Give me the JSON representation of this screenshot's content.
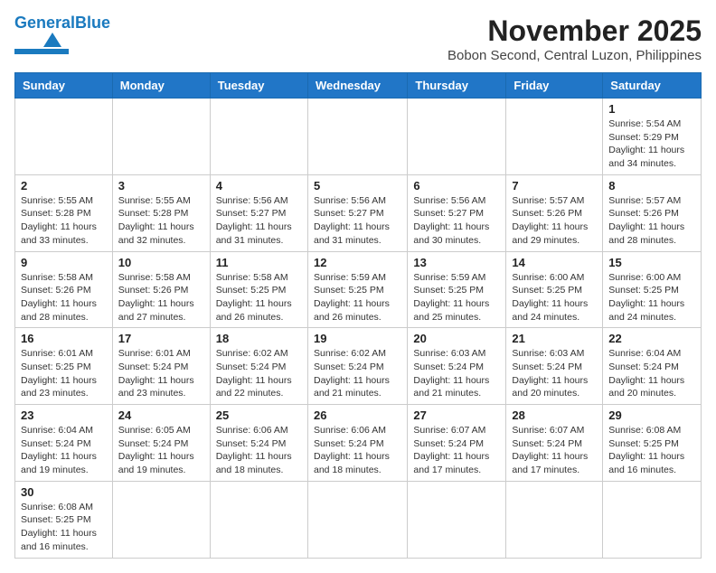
{
  "header": {
    "logo_general": "General",
    "logo_blue": "Blue",
    "month": "November 2025",
    "location": "Bobon Second, Central Luzon, Philippines"
  },
  "days_of_week": [
    "Sunday",
    "Monday",
    "Tuesday",
    "Wednesday",
    "Thursday",
    "Friday",
    "Saturday"
  ],
  "weeks": [
    [
      {
        "day": "",
        "info": ""
      },
      {
        "day": "",
        "info": ""
      },
      {
        "day": "",
        "info": ""
      },
      {
        "day": "",
        "info": ""
      },
      {
        "day": "",
        "info": ""
      },
      {
        "day": "",
        "info": ""
      },
      {
        "day": "1",
        "info": "Sunrise: 5:54 AM\nSunset: 5:29 PM\nDaylight: 11 hours and 34 minutes."
      }
    ],
    [
      {
        "day": "2",
        "info": "Sunrise: 5:55 AM\nSunset: 5:28 PM\nDaylight: 11 hours and 33 minutes."
      },
      {
        "day": "3",
        "info": "Sunrise: 5:55 AM\nSunset: 5:28 PM\nDaylight: 11 hours and 32 minutes."
      },
      {
        "day": "4",
        "info": "Sunrise: 5:56 AM\nSunset: 5:27 PM\nDaylight: 11 hours and 31 minutes."
      },
      {
        "day": "5",
        "info": "Sunrise: 5:56 AM\nSunset: 5:27 PM\nDaylight: 11 hours and 31 minutes."
      },
      {
        "day": "6",
        "info": "Sunrise: 5:56 AM\nSunset: 5:27 PM\nDaylight: 11 hours and 30 minutes."
      },
      {
        "day": "7",
        "info": "Sunrise: 5:57 AM\nSunset: 5:26 PM\nDaylight: 11 hours and 29 minutes."
      },
      {
        "day": "8",
        "info": "Sunrise: 5:57 AM\nSunset: 5:26 PM\nDaylight: 11 hours and 28 minutes."
      }
    ],
    [
      {
        "day": "9",
        "info": "Sunrise: 5:58 AM\nSunset: 5:26 PM\nDaylight: 11 hours and 28 minutes."
      },
      {
        "day": "10",
        "info": "Sunrise: 5:58 AM\nSunset: 5:26 PM\nDaylight: 11 hours and 27 minutes."
      },
      {
        "day": "11",
        "info": "Sunrise: 5:58 AM\nSunset: 5:25 PM\nDaylight: 11 hours and 26 minutes."
      },
      {
        "day": "12",
        "info": "Sunrise: 5:59 AM\nSunset: 5:25 PM\nDaylight: 11 hours and 26 minutes."
      },
      {
        "day": "13",
        "info": "Sunrise: 5:59 AM\nSunset: 5:25 PM\nDaylight: 11 hours and 25 minutes."
      },
      {
        "day": "14",
        "info": "Sunrise: 6:00 AM\nSunset: 5:25 PM\nDaylight: 11 hours and 24 minutes."
      },
      {
        "day": "15",
        "info": "Sunrise: 6:00 AM\nSunset: 5:25 PM\nDaylight: 11 hours and 24 minutes."
      }
    ],
    [
      {
        "day": "16",
        "info": "Sunrise: 6:01 AM\nSunset: 5:25 PM\nDaylight: 11 hours and 23 minutes."
      },
      {
        "day": "17",
        "info": "Sunrise: 6:01 AM\nSunset: 5:24 PM\nDaylight: 11 hours and 23 minutes."
      },
      {
        "day": "18",
        "info": "Sunrise: 6:02 AM\nSunset: 5:24 PM\nDaylight: 11 hours and 22 minutes."
      },
      {
        "day": "19",
        "info": "Sunrise: 6:02 AM\nSunset: 5:24 PM\nDaylight: 11 hours and 21 minutes."
      },
      {
        "day": "20",
        "info": "Sunrise: 6:03 AM\nSunset: 5:24 PM\nDaylight: 11 hours and 21 minutes."
      },
      {
        "day": "21",
        "info": "Sunrise: 6:03 AM\nSunset: 5:24 PM\nDaylight: 11 hours and 20 minutes."
      },
      {
        "day": "22",
        "info": "Sunrise: 6:04 AM\nSunset: 5:24 PM\nDaylight: 11 hours and 20 minutes."
      }
    ],
    [
      {
        "day": "23",
        "info": "Sunrise: 6:04 AM\nSunset: 5:24 PM\nDaylight: 11 hours and 19 minutes."
      },
      {
        "day": "24",
        "info": "Sunrise: 6:05 AM\nSunset: 5:24 PM\nDaylight: 11 hours and 19 minutes."
      },
      {
        "day": "25",
        "info": "Sunrise: 6:06 AM\nSunset: 5:24 PM\nDaylight: 11 hours and 18 minutes."
      },
      {
        "day": "26",
        "info": "Sunrise: 6:06 AM\nSunset: 5:24 PM\nDaylight: 11 hours and 18 minutes."
      },
      {
        "day": "27",
        "info": "Sunrise: 6:07 AM\nSunset: 5:24 PM\nDaylight: 11 hours and 17 minutes."
      },
      {
        "day": "28",
        "info": "Sunrise: 6:07 AM\nSunset: 5:24 PM\nDaylight: 11 hours and 17 minutes."
      },
      {
        "day": "29",
        "info": "Sunrise: 6:08 AM\nSunset: 5:25 PM\nDaylight: 11 hours and 16 minutes."
      }
    ],
    [
      {
        "day": "30",
        "info": "Sunrise: 6:08 AM\nSunset: 5:25 PM\nDaylight: 11 hours and 16 minutes."
      },
      {
        "day": "",
        "info": ""
      },
      {
        "day": "",
        "info": ""
      },
      {
        "day": "",
        "info": ""
      },
      {
        "day": "",
        "info": ""
      },
      {
        "day": "",
        "info": ""
      },
      {
        "day": "",
        "info": ""
      }
    ]
  ]
}
